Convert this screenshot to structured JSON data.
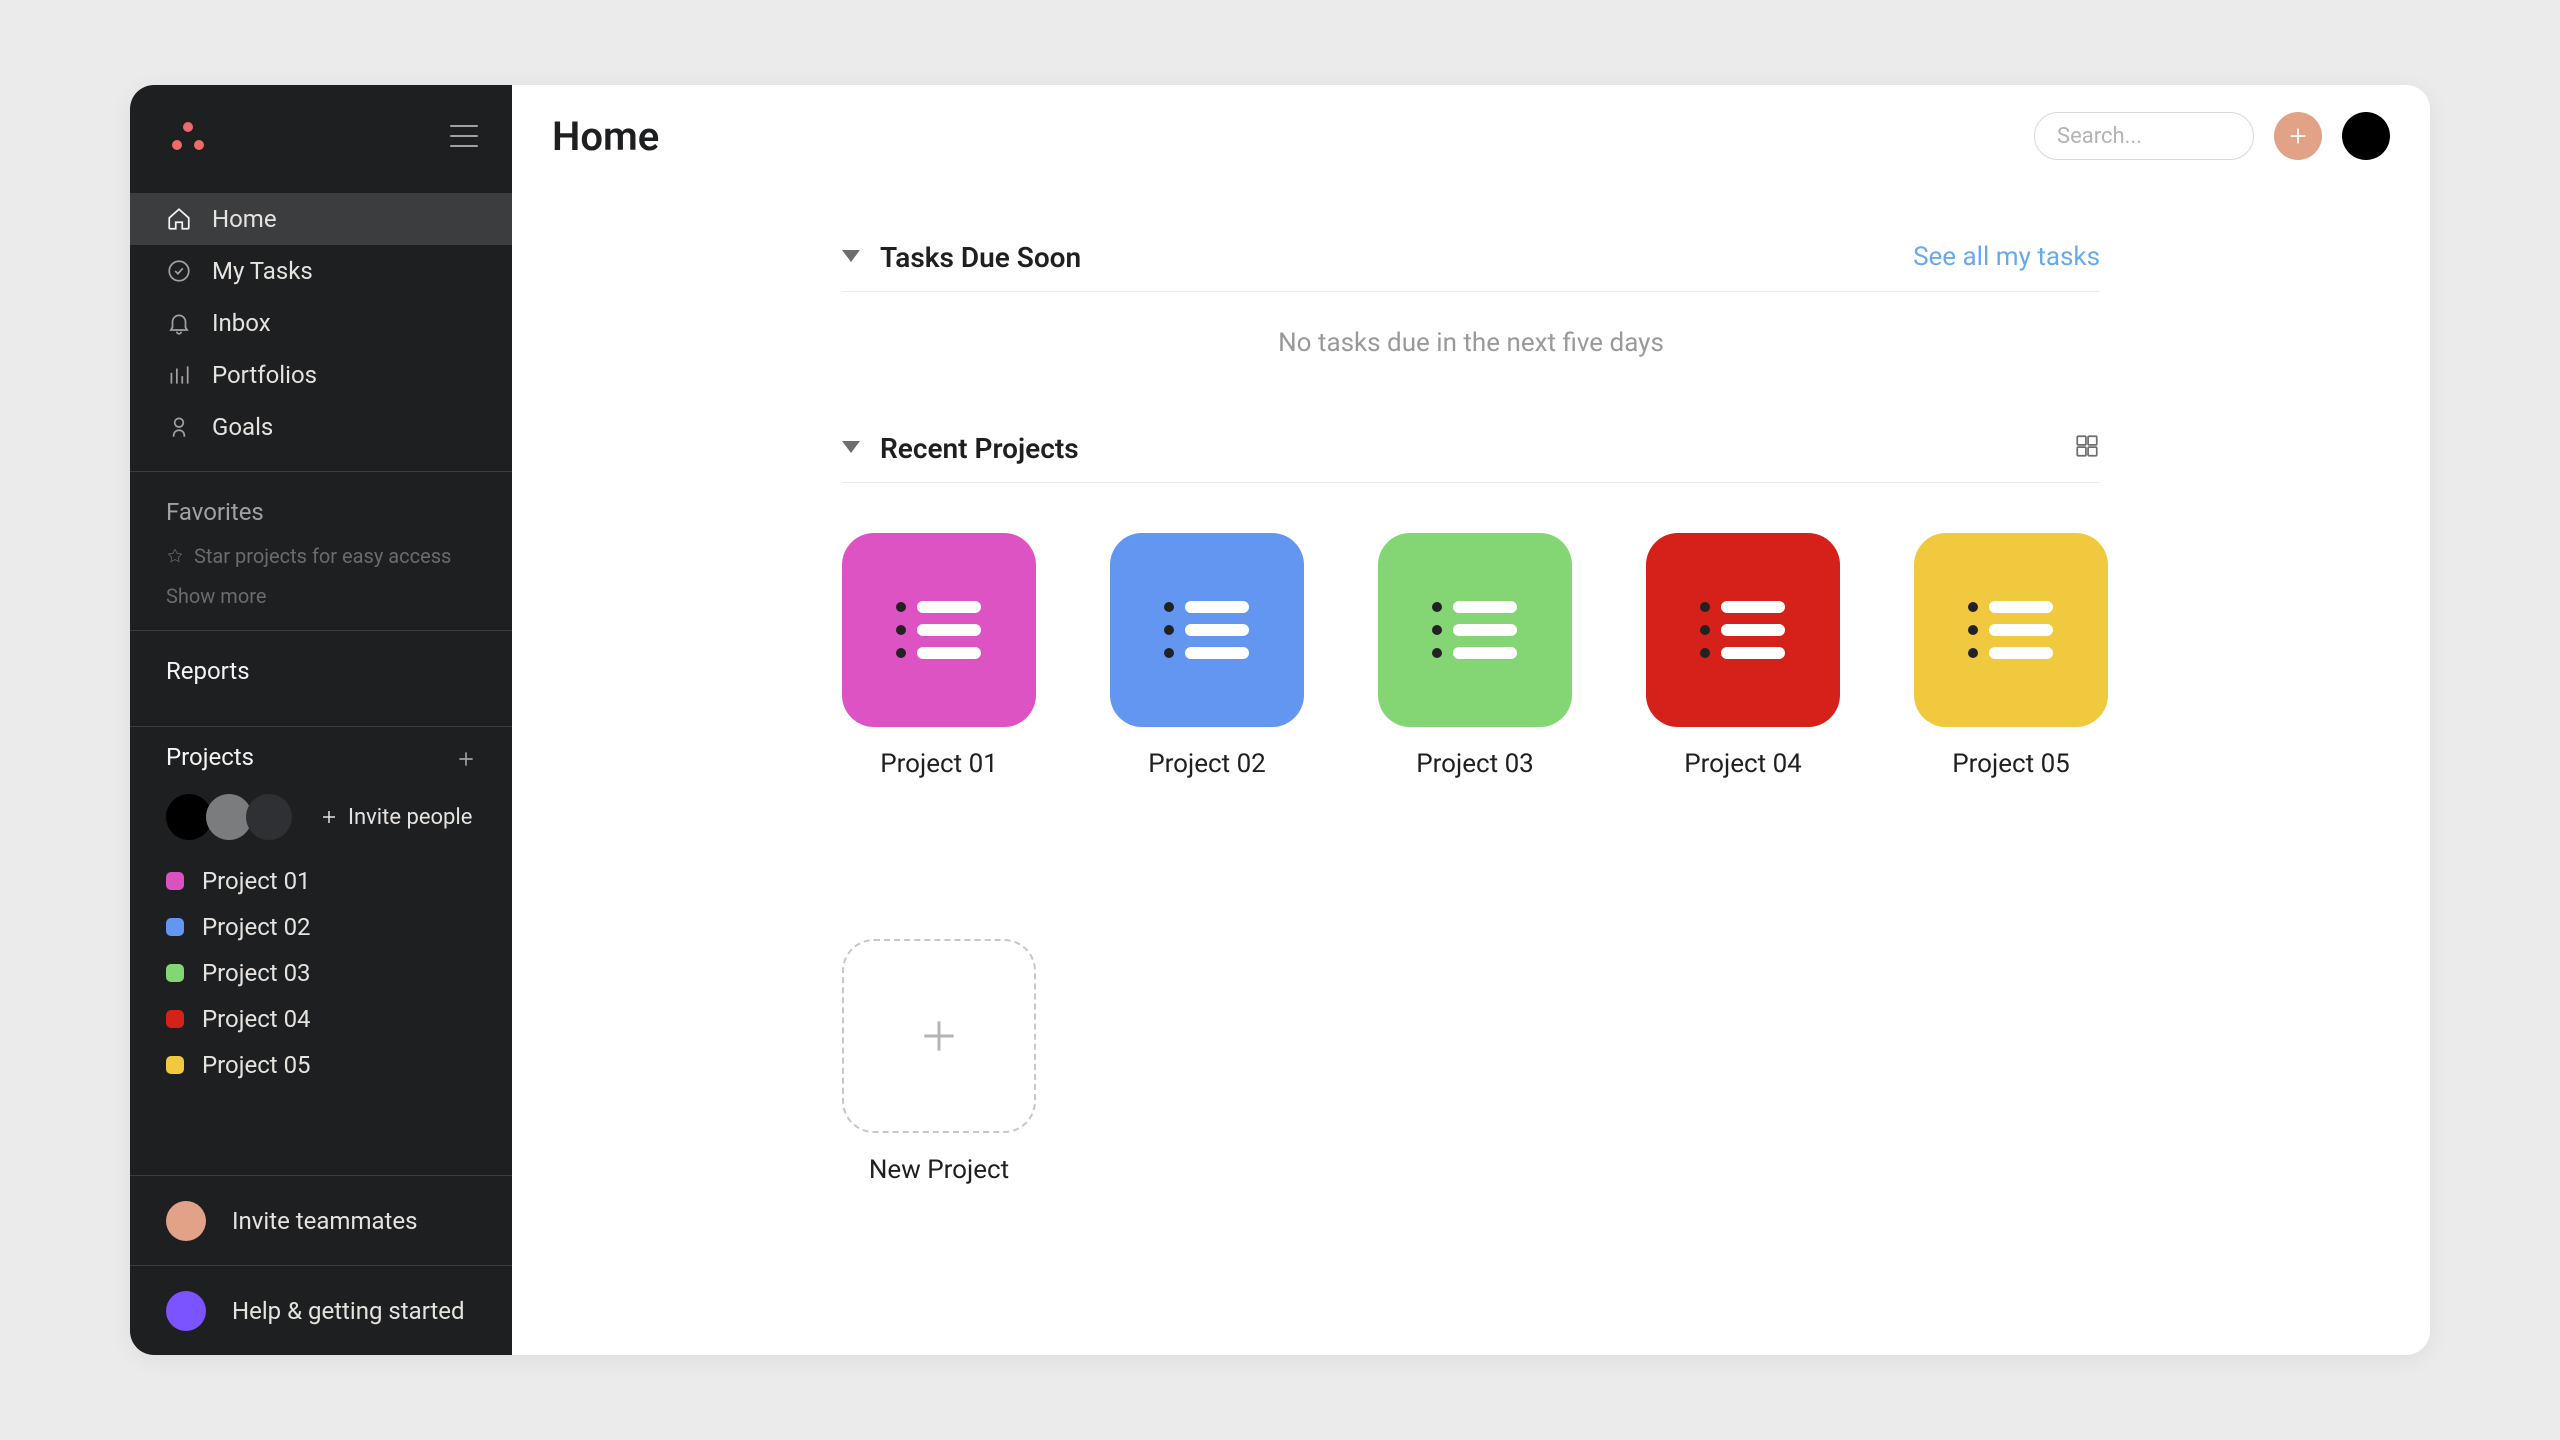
{
  "header": {
    "title": "Home",
    "search_placeholder": "Search..."
  },
  "sidebar": {
    "nav": [
      {
        "label": "Home"
      },
      {
        "label": "My Tasks"
      },
      {
        "label": "Inbox"
      },
      {
        "label": "Portfolios"
      },
      {
        "label": "Goals"
      }
    ],
    "favorites": {
      "title": "Favorites",
      "hint": "Star projects for easy access",
      "show_more": "Show more"
    },
    "reports_label": "Reports",
    "projects_label": "Projects",
    "invite_people_label": "Invite people",
    "project_items": [
      {
        "label": "Project 01",
        "color": "#d952c0"
      },
      {
        "label": "Project 02",
        "color": "#6296f1"
      },
      {
        "label": "Project 03",
        "color": "#84d573"
      },
      {
        "label": "Project 04",
        "color": "#d6201a"
      },
      {
        "label": "Project 05",
        "color": "#f1c93e"
      }
    ],
    "invite_teammates_label": "Invite teammates",
    "help_label": "Help & getting started"
  },
  "sections": {
    "tasks_due": {
      "title": "Tasks Due Soon",
      "see_all": "See all my tasks",
      "empty": "No tasks due in the next five days"
    },
    "recent_projects": {
      "title": "Recent Projects",
      "new_project_label": "New Project",
      "projects": [
        {
          "name": "Project 01",
          "color": "#dd53c3"
        },
        {
          "name": "Project 02",
          "color": "#6296f1"
        },
        {
          "name": "Project 03",
          "color": "#84d573"
        },
        {
          "name": "Project 04",
          "color": "#d6201a"
        },
        {
          "name": "Project 05",
          "color": "#f1c93e"
        }
      ]
    }
  },
  "colors": {
    "invite_teammates_circle": "#e2a288",
    "help_circle": "#7b53ff"
  }
}
